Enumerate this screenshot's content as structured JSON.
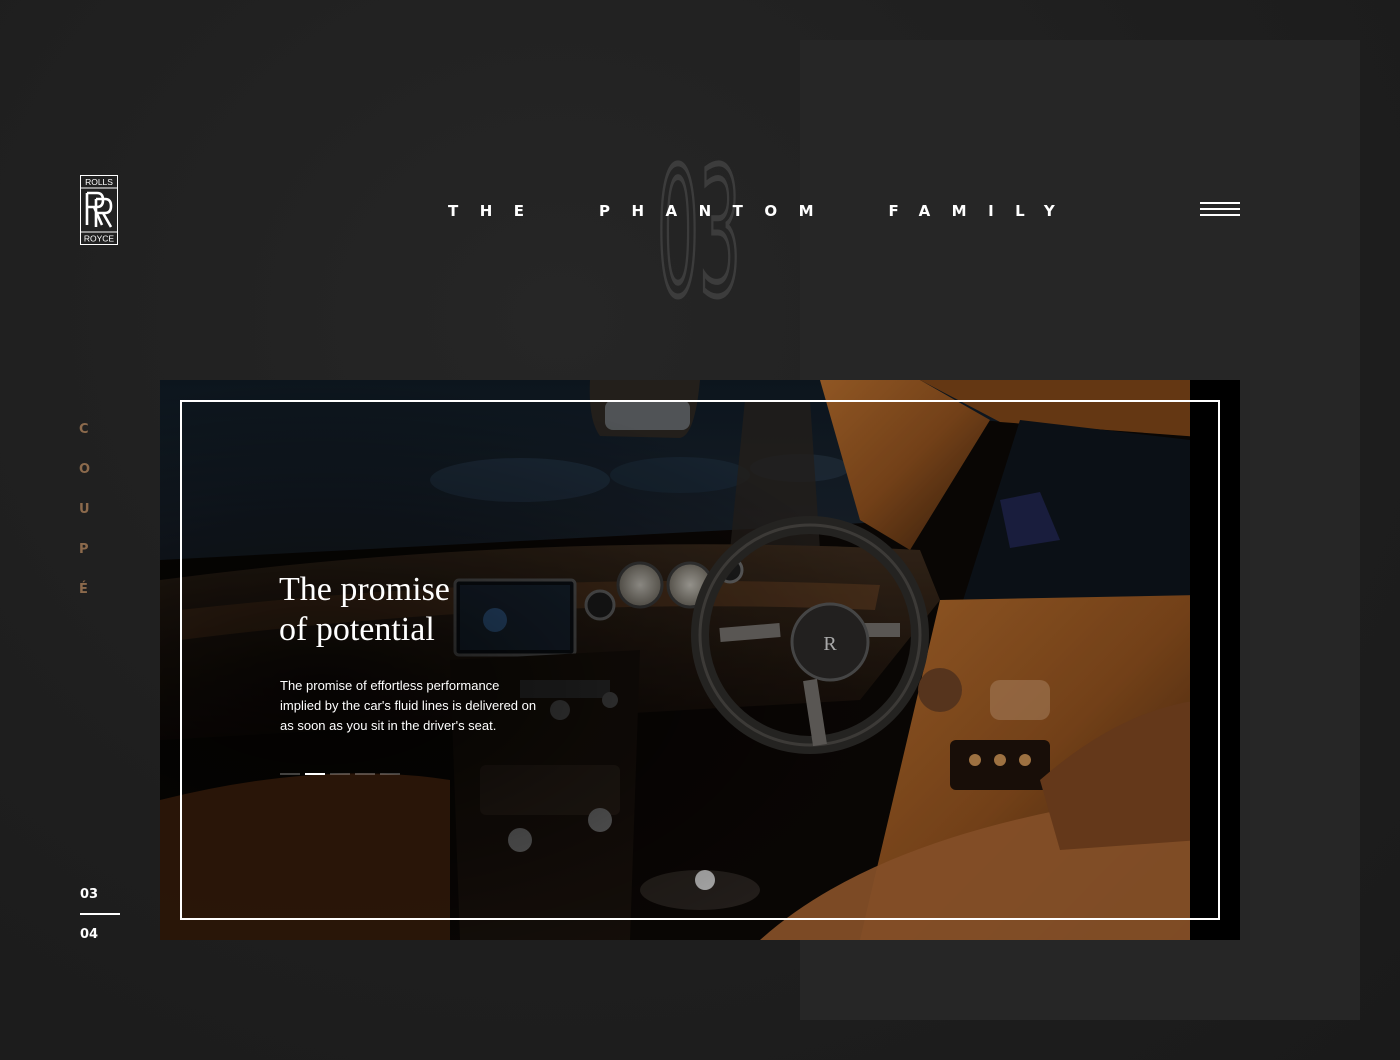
{
  "brand": {
    "name": "Rolls-Royce",
    "logo_top": "ROLLS",
    "logo_bottom": "ROYCE",
    "logo_monogram": "RR"
  },
  "header": {
    "title": "THE  PHANTOM  FAMILY",
    "section_number": "03",
    "menu_icon": "hamburger-icon"
  },
  "sidebar": {
    "vertical_label": [
      "C",
      "O",
      "U",
      "P",
      "É"
    ],
    "pager_current": "03",
    "pager_total": "04"
  },
  "hero": {
    "heading_line1": "The promise",
    "heading_line2": "of potential",
    "description": "The promise of effortless performance implied by the car's fluid lines is delivered on as soon as you sit in the driver's seat.",
    "slides_total": 5,
    "active_slide": 2
  },
  "colors": {
    "background": "#1f1f1f",
    "panel": "#262626",
    "accent": "#8c6a4c",
    "text": "#ffffff",
    "leather": "#9a5a24"
  }
}
